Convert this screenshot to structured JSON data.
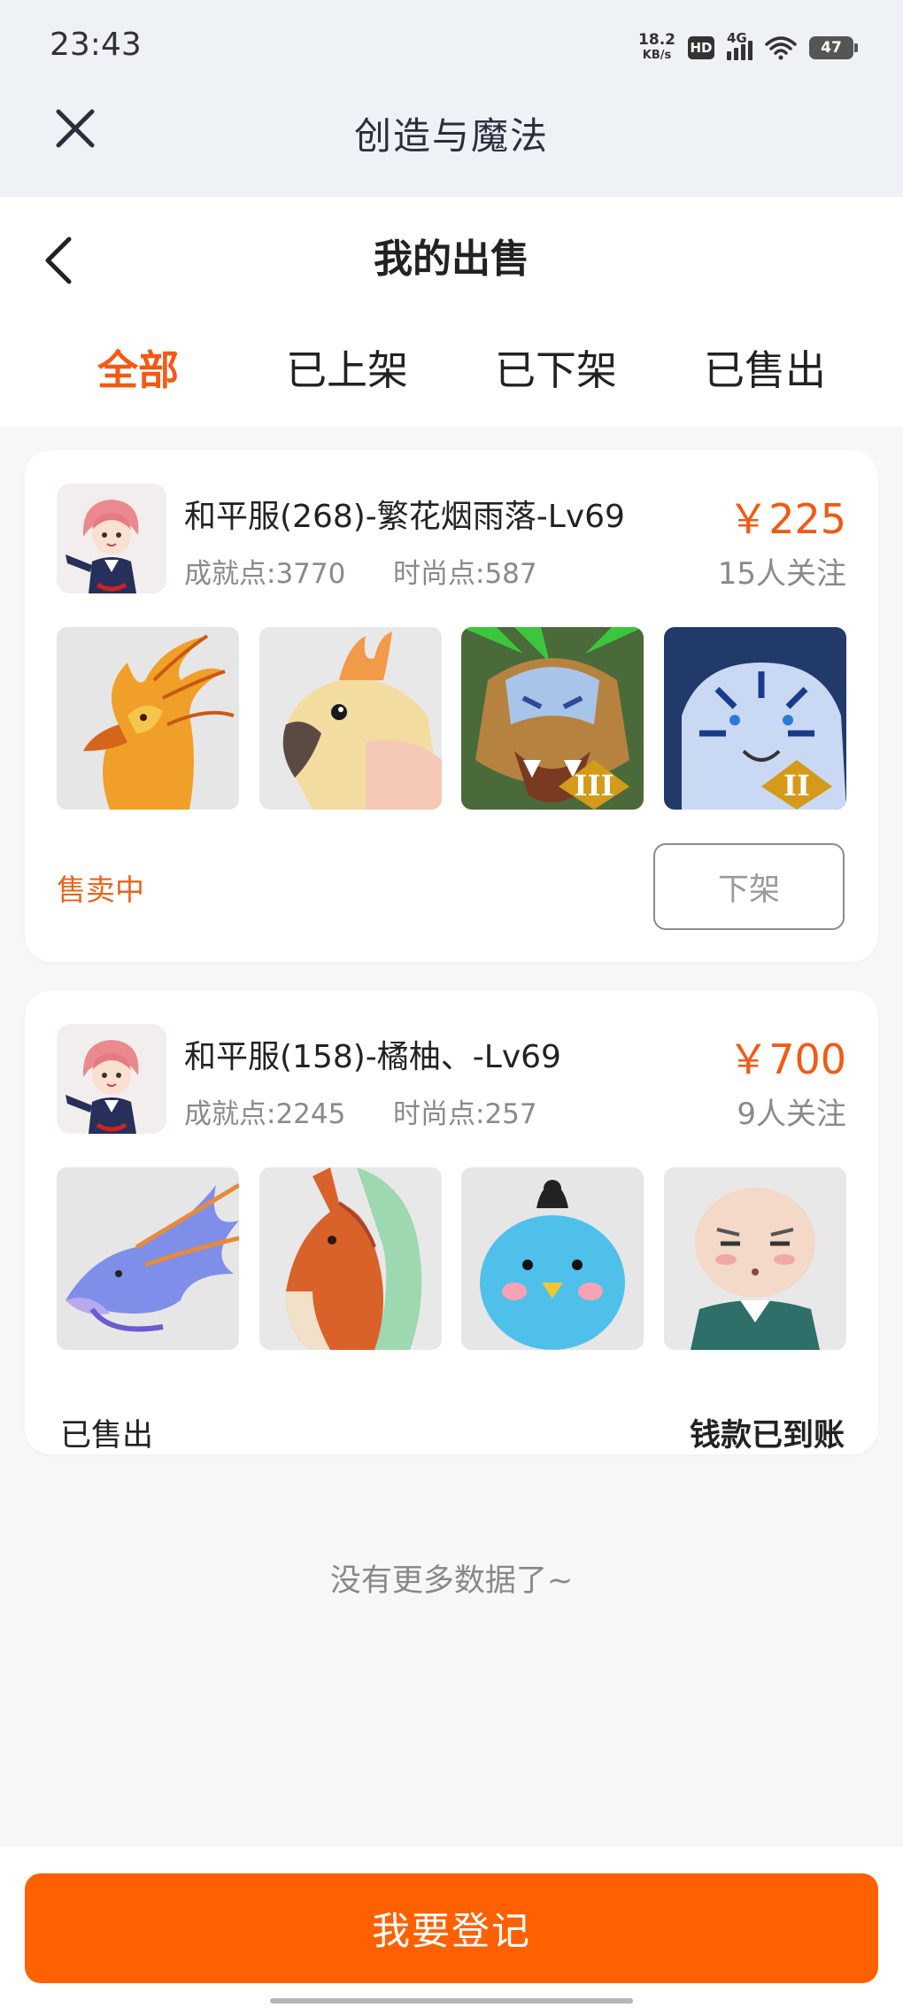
{
  "status_bar": {
    "time": "23:43",
    "net_speed_value": "18.2",
    "net_speed_unit": "KB/s",
    "hd_label": "HD",
    "network_label": "4G",
    "battery": "47"
  },
  "app_bar": {
    "title": "创造与魔法",
    "close_icon": "close-icon"
  },
  "header": {
    "title": "我的出售",
    "back_icon": "chevron-left-icon"
  },
  "tabs": [
    {
      "label": "全部",
      "active": true
    },
    {
      "label": "已上架",
      "active": false
    },
    {
      "label": "已下架",
      "active": false
    },
    {
      "label": "已售出",
      "active": false
    }
  ],
  "listings": [
    {
      "name": "和平服(268)-繁花烟雨落-Lv69",
      "achievement": "成就点:3770",
      "fashion": "时尚点:587",
      "price": "￥225",
      "followers": "15人关注",
      "status": "售卖中",
      "action_label": "下架",
      "thumbs": [
        "phoenix-mount-icon",
        "cockatoo-mount-icon",
        "lion-mount-icon",
        "tiger-mount-icon"
      ],
      "badges": [
        "",
        "",
        "III",
        "II"
      ]
    },
    {
      "name": "和平服(158)-橘柚、-Lv69",
      "achievement": "成就点:2245",
      "fashion": "时尚点:257",
      "price": "￥700",
      "followers": "9人关注",
      "status": "已售出",
      "settlement": "钱款已到账",
      "thumbs": [
        "dragon-mount-icon",
        "horse-mount-icon",
        "blue-bird-pet-icon",
        "bald-character-icon"
      ]
    }
  ],
  "footer": {
    "no_more": "没有更多数据了~",
    "register_label": "我要登记"
  },
  "colors": {
    "accent": "#f25a14",
    "button": "#ff6000",
    "topbar": "#eef1f6"
  }
}
